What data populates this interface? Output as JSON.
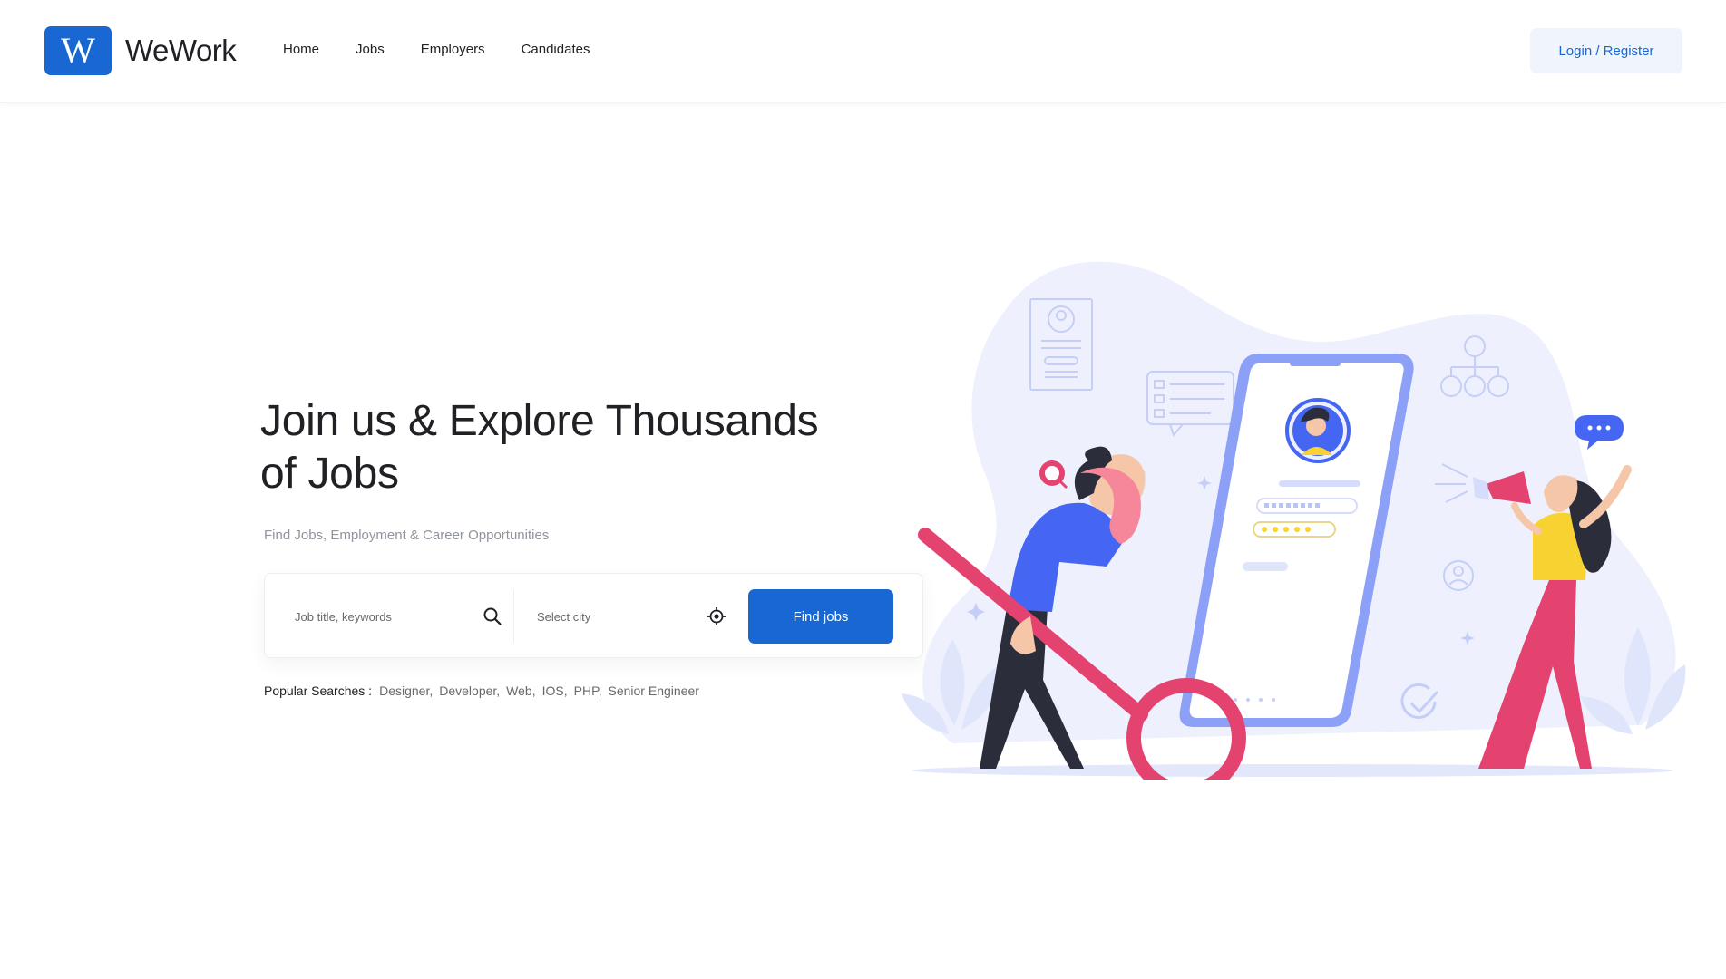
{
  "brand": {
    "logo_letter": "W",
    "name": "WeWork",
    "accent": "#1967d2"
  },
  "nav": {
    "items": [
      {
        "label": "Home"
      },
      {
        "label": "Jobs"
      },
      {
        "label": "Employers"
      },
      {
        "label": "Candidates"
      }
    ],
    "login_label": "Login / Register"
  },
  "hero": {
    "title": "Join us & Explore Thousands of Jobs",
    "subtitle": "Find Jobs, Employment & Career Opportunities"
  },
  "search": {
    "keywords_placeholder": "Job title, keywords",
    "city_placeholder": "Select city",
    "submit_label": "Find jobs",
    "keywords_icon": "search-icon",
    "city_icon": "location-crosshair-icon"
  },
  "popular": {
    "label": "Popular Searches :",
    "tags": [
      "Designer,",
      "Developer,",
      "Web,",
      "IOS,",
      "PHP,",
      "Senior Engineer"
    ]
  },
  "illustration": {
    "name": "job-search-illustration",
    "colors": {
      "blob": "#eef1fd",
      "blue": "#4466f2",
      "pink": "#e4436f",
      "yellow": "#f8d231",
      "dark": "#2b2d3a"
    }
  }
}
